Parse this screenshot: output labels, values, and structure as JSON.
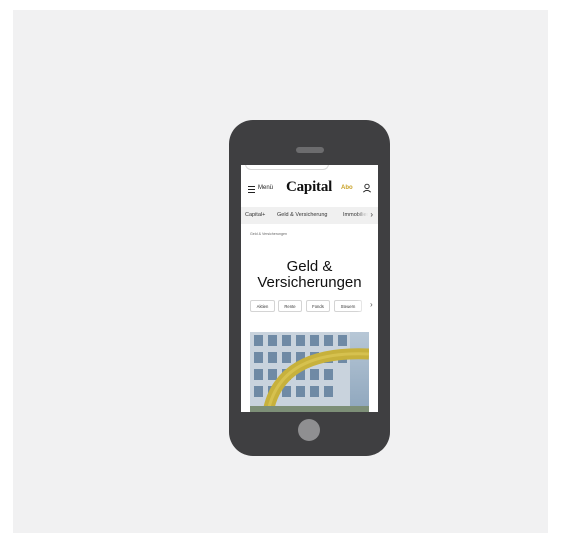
{
  "header": {
    "menu_label": "Menü",
    "logo": "Capital",
    "subscribe_label": "Abo"
  },
  "nav": {
    "items": [
      "Capital+",
      "Geld & Versicherung",
      "Immobilien"
    ]
  },
  "breadcrumb": "Geld & Versicherungen",
  "page": {
    "title_line1": "Geld &",
    "title_line2": "Versicherungen"
  },
  "chips": [
    "Aktien",
    "Rente",
    "Fonds",
    "Steuern"
  ],
  "colors": {
    "accent": "#c9a227",
    "phone_body": "#3f3f41",
    "background": "#f1f1f2"
  }
}
